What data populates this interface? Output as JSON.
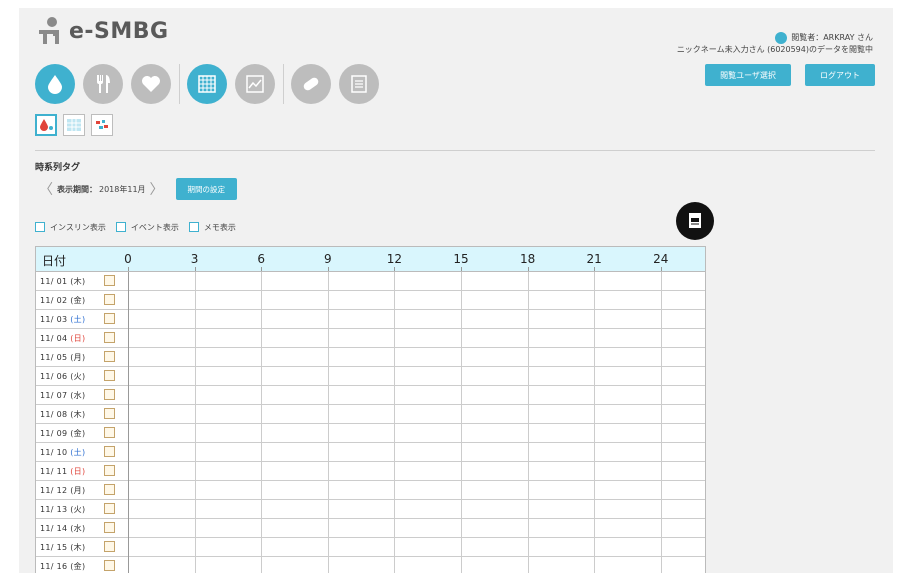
{
  "app": {
    "title": "e-SMBG"
  },
  "nav": {
    "items": [
      {
        "name": "nav-blood-glucose",
        "icon": "blood-drop-icon",
        "active": true
      },
      {
        "name": "nav-meal",
        "icon": "fork-knife-icon",
        "active": false
      },
      {
        "name": "nav-health",
        "icon": "heart-icon",
        "active": false
      },
      {
        "name": "nav-table",
        "icon": "grid-table-icon",
        "active": true
      },
      {
        "name": "nav-graph",
        "icon": "line-graph-icon",
        "active": false
      },
      {
        "name": "nav-medication",
        "icon": "pill-icon",
        "active": false
      },
      {
        "name": "nav-notes",
        "icon": "document-list-icon",
        "active": false
      }
    ],
    "subviews": [
      {
        "name": "subview-timeline",
        "icon": "drop-timeline-icon",
        "selected": true
      },
      {
        "name": "subview-grid",
        "icon": "grid-icon",
        "selected": false
      },
      {
        "name": "subview-scatter",
        "icon": "scatter-icon",
        "selected": false
      }
    ]
  },
  "user": {
    "viewer": "閲覧者：ARKRAY さん",
    "viewing": "ニックネーム未入力さん (6020594)のデータを閲覧中",
    "select_user_label": "閲覧ユーザ選択",
    "logout_label": "ログアウト"
  },
  "section": {
    "title": "時系列タグ",
    "period_label": "表示期間：",
    "period_value": "2018年11月",
    "period_button": "期間の設定"
  },
  "options": {
    "insulin": "インスリン表示",
    "event": "イベント表示",
    "memo": "メモ表示"
  },
  "table": {
    "date_header": "日付",
    "hours": [
      "0",
      "3",
      "6",
      "9",
      "12",
      "15",
      "18",
      "21",
      "24"
    ],
    "rows": [
      {
        "date": "11/ 01",
        "weekday": "(木)",
        "type": "weekday"
      },
      {
        "date": "11/ 02",
        "weekday": "(金)",
        "type": "weekday"
      },
      {
        "date": "11/ 03",
        "weekday": "(土)",
        "type": "sat"
      },
      {
        "date": "11/ 04",
        "weekday": "(日)",
        "type": "sun"
      },
      {
        "date": "11/ 05",
        "weekday": "(月)",
        "type": "weekday"
      },
      {
        "date": "11/ 06",
        "weekday": "(火)",
        "type": "weekday"
      },
      {
        "date": "11/ 07",
        "weekday": "(水)",
        "type": "weekday"
      },
      {
        "date": "11/ 08",
        "weekday": "(木)",
        "type": "weekday"
      },
      {
        "date": "11/ 09",
        "weekday": "(金)",
        "type": "weekday"
      },
      {
        "date": "11/ 10",
        "weekday": "(土)",
        "type": "sat"
      },
      {
        "date": "11/ 11",
        "weekday": "(日)",
        "type": "sun"
      },
      {
        "date": "11/ 12",
        "weekday": "(月)",
        "type": "weekday"
      },
      {
        "date": "11/ 13",
        "weekday": "(火)",
        "type": "weekday"
      },
      {
        "date": "11/ 14",
        "weekday": "(水)",
        "type": "weekday"
      },
      {
        "date": "11/ 15",
        "weekday": "(木)",
        "type": "weekday"
      },
      {
        "date": "11/ 16",
        "weekday": "(金)",
        "type": "weekday"
      }
    ]
  },
  "colors": {
    "accent": "#3fb1cf",
    "inactive": "#bdbdbd",
    "saturday": "#2e6fd1",
    "sunday": "#e0453b",
    "header_bg": "#d9f6fd"
  }
}
